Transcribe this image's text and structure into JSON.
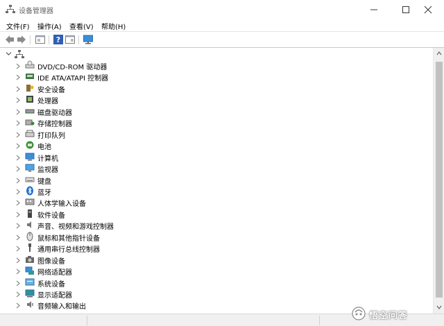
{
  "window": {
    "title": "设备管理器"
  },
  "menu": [
    "文件(F)",
    "操作(A)",
    "查看(V)",
    "帮助(H)"
  ],
  "toolbar": [
    "back-icon",
    "forward-icon",
    "properties-icon",
    "help-icon",
    "details-icon",
    "monitor-icon"
  ],
  "tree": {
    "root": {
      "icon": "computer-icon",
      "label": ""
    },
    "nodes": [
      {
        "label": "DVD/CD-ROM 驱动器",
        "icon": "dvd-drive"
      },
      {
        "label": "IDE ATA/ATAPI 控制器",
        "icon": "ide-controller"
      },
      {
        "label": "安全设备",
        "icon": "security-device"
      },
      {
        "label": "处理器",
        "icon": "processor"
      },
      {
        "label": "磁盘驱动器",
        "icon": "disk-drive"
      },
      {
        "label": "存储控制器",
        "icon": "storage-controller"
      },
      {
        "label": "打印队列",
        "icon": "printer"
      },
      {
        "label": "电池",
        "icon": "battery"
      },
      {
        "label": "计算机",
        "icon": "computer"
      },
      {
        "label": "监视器",
        "icon": "monitor"
      },
      {
        "label": "键盘",
        "icon": "keyboard"
      },
      {
        "label": "蓝牙",
        "icon": "bluetooth"
      },
      {
        "label": "人体学输入设备",
        "icon": "hid"
      },
      {
        "label": "软件设备",
        "icon": "software-device"
      },
      {
        "label": "声音、视频和游戏控制器",
        "icon": "sound"
      },
      {
        "label": "鼠标和其他指针设备",
        "icon": "mouse"
      },
      {
        "label": "通用串行总线控制器",
        "icon": "usb"
      },
      {
        "label": "图像设备",
        "icon": "imaging"
      },
      {
        "label": "网络适配器",
        "icon": "network"
      },
      {
        "label": "系统设备",
        "icon": "system"
      },
      {
        "label": "显示适配器",
        "icon": "display-adapter"
      },
      {
        "label": "音频输入和输出",
        "icon": "audio-io"
      }
    ]
  },
  "watermark": {
    "text": "悟空问答"
  }
}
